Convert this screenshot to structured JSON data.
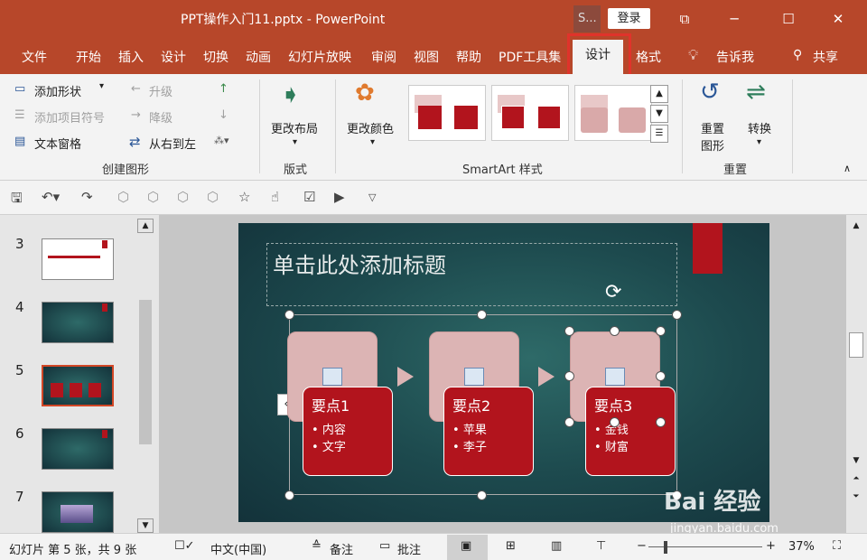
{
  "titlebar": {
    "document": "PPT操作入门11.pptx  -  PowerPoint",
    "s_button": "S...",
    "login": "登录"
  },
  "tabs": [
    "文件",
    "开始",
    "插入",
    "设计",
    "切换",
    "动画",
    "幻灯片放映",
    "审阅",
    "视图",
    "帮助",
    "PDF工具集",
    "设计",
    "格式",
    "告诉我",
    "共享"
  ],
  "ribbon": {
    "create_group": {
      "label": "创建图形",
      "add_shape": "添加形状",
      "add_bullet": "添加项目符号",
      "text_pane": "文本窗格",
      "promote": "升级",
      "demote": "降级",
      "rtl": "从右到左"
    },
    "layout_group": {
      "label": "版式",
      "change_layout": "更改布局"
    },
    "style_group": {
      "label": "SmartArt 样式",
      "change_color": "更改颜色"
    },
    "reset_group": {
      "label": "重置",
      "reset_graphic_1": "重置",
      "reset_graphic_2": "图形",
      "convert": "转换"
    }
  },
  "slides": [
    {
      "num": "3"
    },
    {
      "num": "4"
    },
    {
      "num": "5"
    },
    {
      "num": "6"
    },
    {
      "num": "7"
    }
  ],
  "slide": {
    "title_placeholder": "单击此处添加标题",
    "cards": [
      {
        "title": "要点1",
        "b1": "内容",
        "b2": "文字"
      },
      {
        "title": "要点2",
        "b1": "苹果",
        "b2": "李子"
      },
      {
        "title": "要点3",
        "b1": "金钱",
        "b2": "财富"
      }
    ]
  },
  "status": {
    "slide_info": "幻灯片 第 5 张，共 9 张",
    "language": "中文(中国)",
    "notes": "备注",
    "comments": "批注",
    "zoom": "37%"
  },
  "watermark": {
    "brand": "Bai  经验",
    "url": "jingyan.baidu.com"
  },
  "colors": {
    "accent": "#b7472a",
    "highlight": "#e0332b",
    "card_red": "#b2141d",
    "card_pink": "#dcb4b4"
  }
}
